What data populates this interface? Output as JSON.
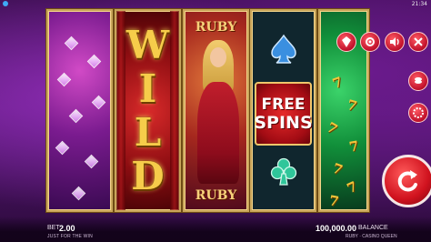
{
  "status_bar": {
    "time": "21:34"
  },
  "reels": {
    "reel2": {
      "wild_letters": [
        "W",
        "I",
        "L",
        "D"
      ]
    },
    "reel3": {
      "top_label": "RUBY",
      "bottom_label": "RUBY"
    },
    "reel4": {
      "free_spins_line1": "FREE",
      "free_spins_line2": "SPINS",
      "top_symbol": "spade-icon",
      "bottom_symbol": "club-icon"
    },
    "reel5": {
      "sevens": [
        "7",
        "7",
        "7",
        "7",
        "7",
        "7",
        "7"
      ]
    }
  },
  "controls": {
    "icons": [
      "ruby-logo-icon",
      "gear-icon",
      "speaker-icon",
      "close-icon",
      "coins-icon",
      "chips-icon",
      "spin-icon"
    ]
  },
  "bottom_bar": {
    "bet_label": "BET",
    "bet_value": "2.00",
    "bet_sub": "JUST FOR THE WIN",
    "balance_value": "100,000.00",
    "balance_label": "BALANCE",
    "balance_sub": "RUBY · CASINO QUEEN"
  },
  "colors": {
    "accent_red": "#d0121e",
    "gold": "#f6cc4a",
    "background": "#3d0f52"
  }
}
